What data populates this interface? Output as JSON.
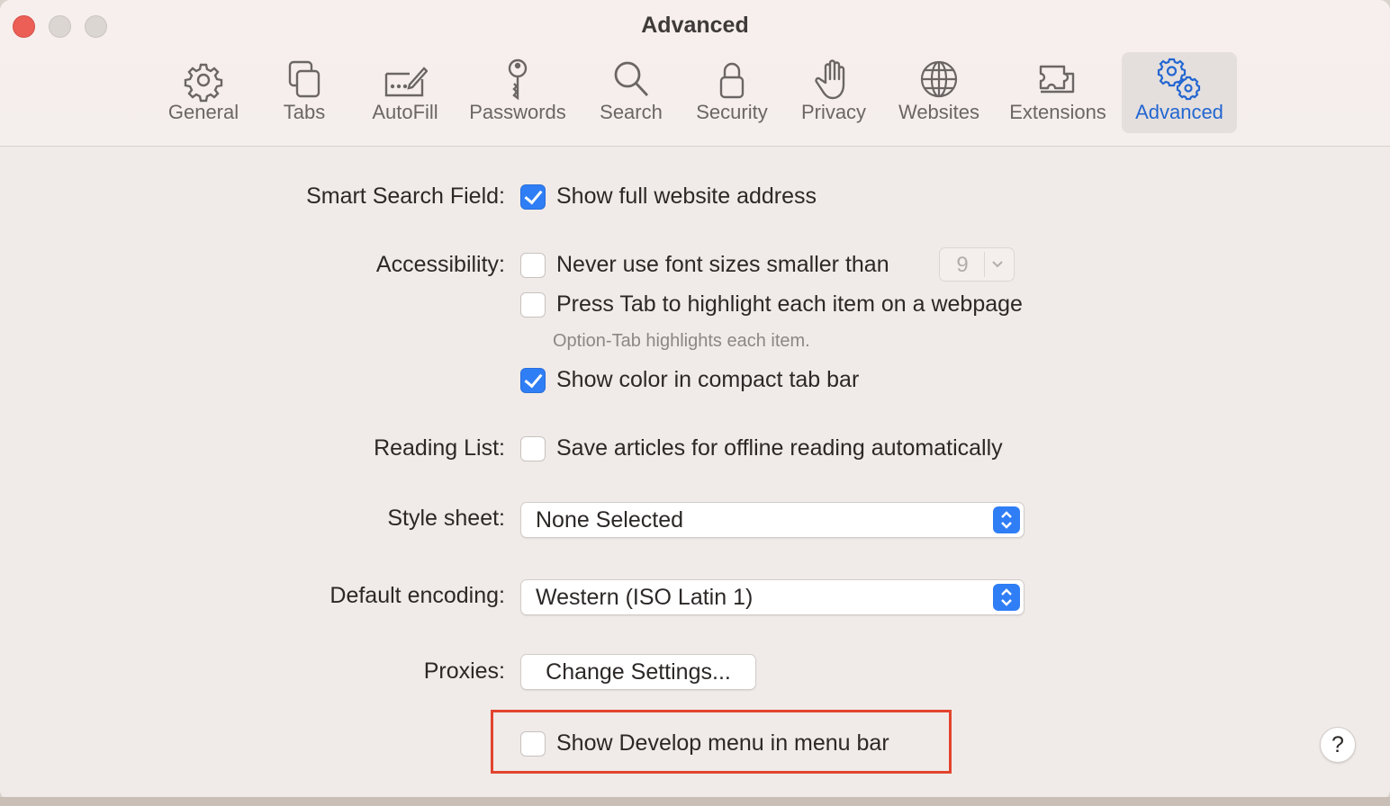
{
  "window": {
    "title": "Advanced"
  },
  "toolbar": {
    "tabs": [
      {
        "label": "General",
        "icon": "gear-icon"
      },
      {
        "label": "Tabs",
        "icon": "tabs-icon"
      },
      {
        "label": "AutoFill",
        "icon": "autofill-icon"
      },
      {
        "label": "Passwords",
        "icon": "key-icon"
      },
      {
        "label": "Search",
        "icon": "magnifier-icon"
      },
      {
        "label": "Security",
        "icon": "lock-icon"
      },
      {
        "label": "Privacy",
        "icon": "hand-icon"
      },
      {
        "label": "Websites",
        "icon": "globe-icon"
      },
      {
        "label": "Extensions",
        "icon": "puzzle-icon"
      },
      {
        "label": "Advanced",
        "icon": "gears-icon",
        "selected": true
      }
    ]
  },
  "settings": {
    "smart_search": {
      "label": "Smart Search Field:",
      "show_full_address": {
        "text": "Show full website address",
        "checked": true
      }
    },
    "accessibility": {
      "label": "Accessibility:",
      "min_font": {
        "text": "Never use font sizes smaller than",
        "checked": false,
        "value": "9"
      },
      "tab_highlight": {
        "text": "Press Tab to highlight each item on a webpage",
        "checked": false
      },
      "hint": "Option-Tab highlights each item.",
      "compact_color": {
        "text": "Show color in compact tab bar",
        "checked": true
      }
    },
    "reading_list": {
      "label": "Reading List:",
      "save_offline": {
        "text": "Save articles for offline reading automatically",
        "checked": false
      }
    },
    "style_sheet": {
      "label": "Style sheet:",
      "value": "None Selected"
    },
    "default_encoding": {
      "label": "Default encoding:",
      "value": "Western (ISO Latin 1)"
    },
    "proxies": {
      "label": "Proxies:",
      "button": "Change Settings..."
    },
    "develop_menu": {
      "text": "Show Develop menu in menu bar",
      "checked": false
    }
  },
  "help": {
    "label": "?"
  },
  "colors": {
    "accent": "#2f7ef5",
    "highlight_box": "#e2442f",
    "close_button": "#ec5f56"
  }
}
